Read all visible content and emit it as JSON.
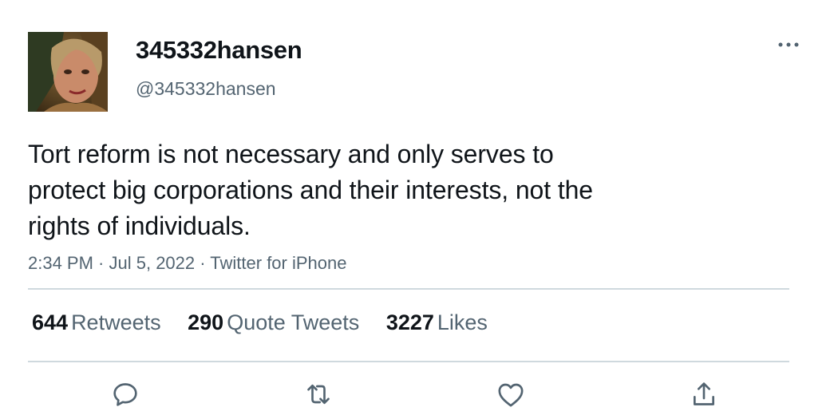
{
  "user": {
    "display_name": "345332hansen",
    "handle": "@345332hansen"
  },
  "tweet": {
    "text": "Tort reform is not necessary and only serves to\nprotect big corporations and their interests, not the\nrights of individuals.",
    "time": "2:34 PM",
    "date": "Jul 5, 2022",
    "source": "Twitter for iPhone",
    "separator": " · "
  },
  "stats": [
    {
      "count": "644",
      "label": "Retweets"
    },
    {
      "count": "290",
      "label": "Quote Tweets"
    },
    {
      "count": "3227",
      "label": "Likes"
    }
  ],
  "icons": {
    "more": "more-horizontal-icon",
    "reply": "reply-icon",
    "retweet": "retweet-icon",
    "like": "heart-icon",
    "share": "share-icon"
  },
  "colors": {
    "text": "#0f1419",
    "secondary": "#536471",
    "divider": "#cfd9de"
  }
}
